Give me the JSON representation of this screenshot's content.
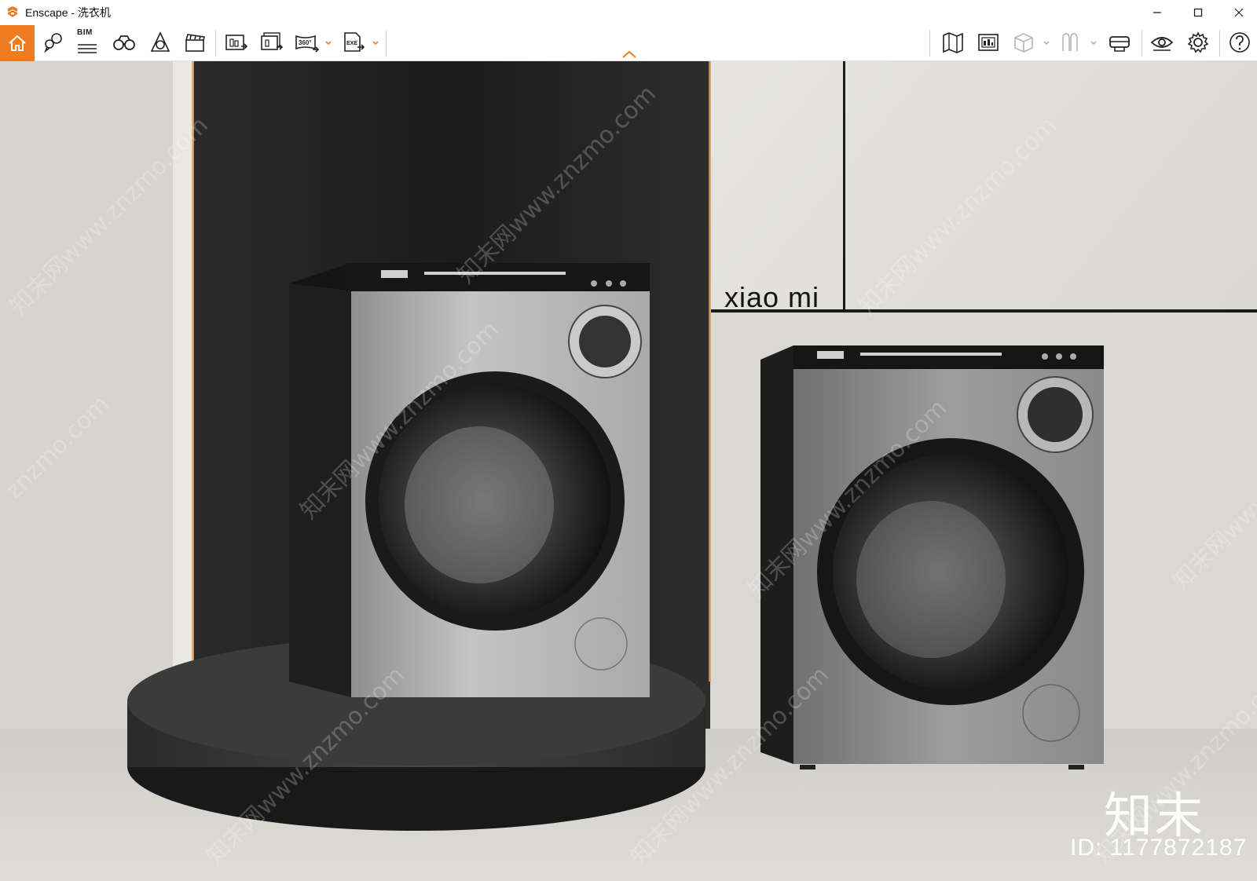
{
  "window": {
    "app_name": "Enscape",
    "title": "Enscape - 洗衣机",
    "minimize_label": "minimize",
    "maximize_label": "maximize",
    "close_label": "close"
  },
  "toolbar": {
    "bim_label": "BIM",
    "pano_label": "360°",
    "exe_label": "EXE",
    "accent_color": "#f07c22",
    "left_icons": [
      "home-icon",
      "location-pin-icon",
      "bim-icon",
      "binoculars-icon",
      "asset-library-icon",
      "video-editor-icon",
      "screenshot-icon",
      "batch-render-icon",
      "panorama-360-icon",
      "exe-export-icon"
    ],
    "right_icons": [
      "map-icon",
      "visual-settings-icon",
      "cube-view-icon",
      "vr-headset-icon",
      "vr-icon",
      "eye-icon",
      "gear-icon",
      "help-icon"
    ]
  },
  "scene": {
    "brand_text": "xiao mi",
    "watermark_logo": "知末",
    "watermark_id": "ID: 1177872187",
    "watermark_tiles": [
      "知末网www.znzmo.com",
      "知末网www.znzmo.com",
      "知末网www.znzmo.com",
      "知末网www.znzmo.com",
      "znzmo.com",
      "知末网www.znzmo.com",
      "知末网www.znzmo.com",
      "知末网www.znzmo.com",
      "知末网www.znzmo.com",
      "知末网www.znzmo.com"
    ]
  }
}
